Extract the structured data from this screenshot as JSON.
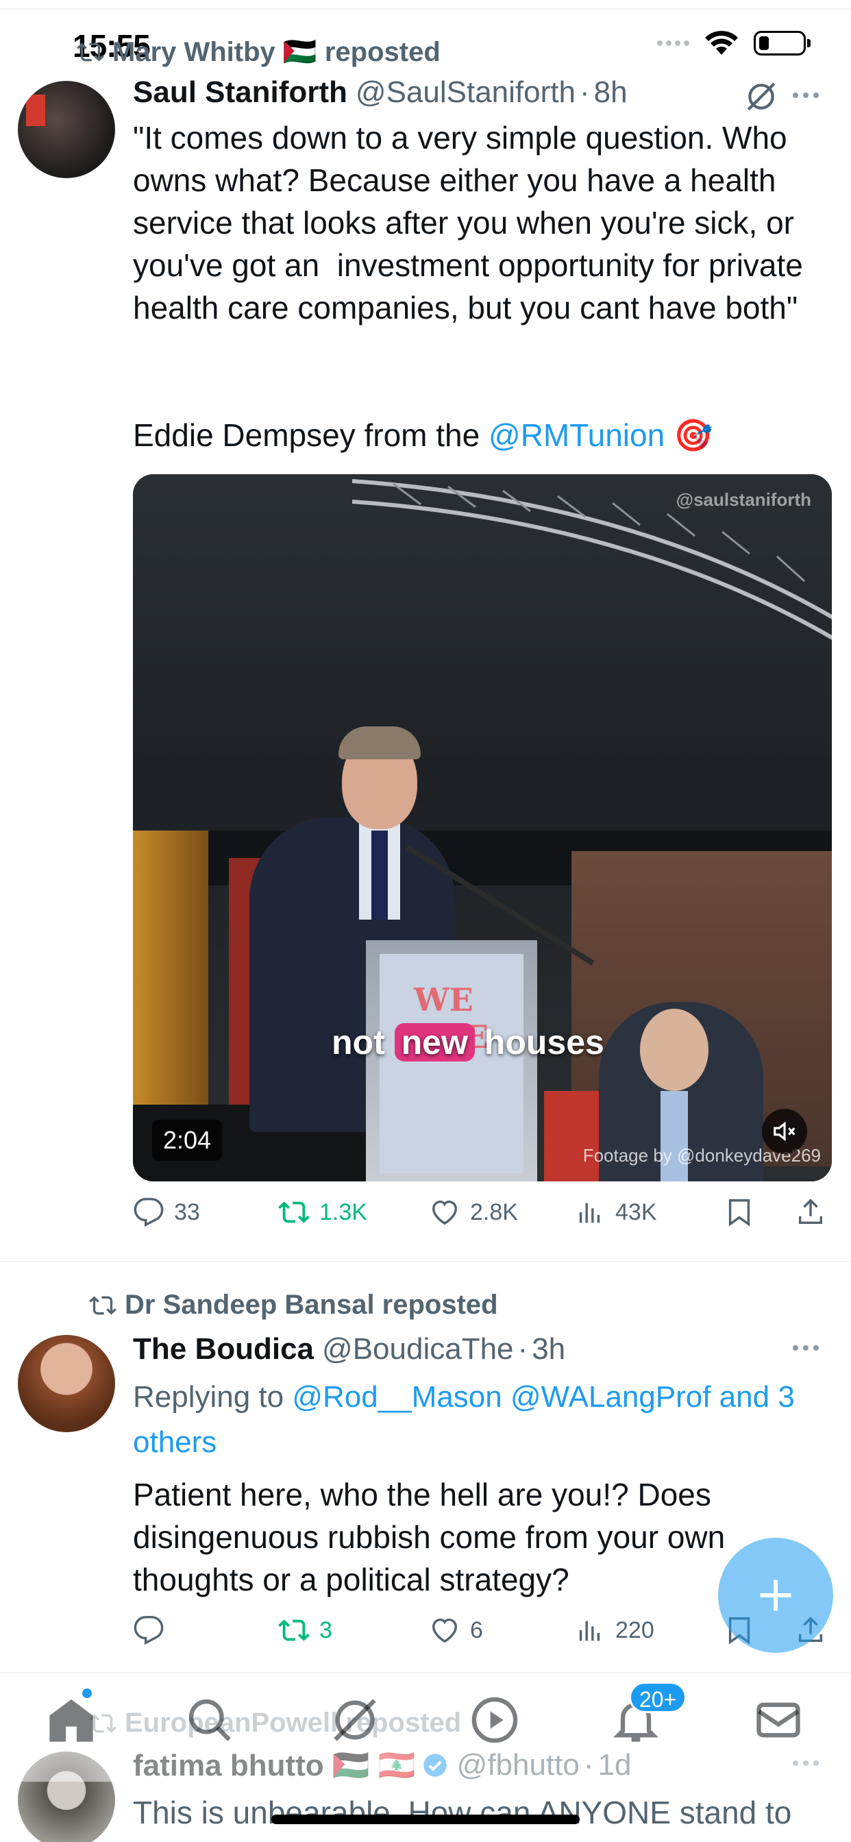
{
  "status_bar": {
    "time": "15:55"
  },
  "tweets": [
    {
      "context": "Mary Whitby 🇵🇸 reposted",
      "name": "Saul Staniforth",
      "handle": "@SaulStaniforth",
      "age": "8h",
      "text": "\"It comes down to a very simple question. Who owns what? Because either you have a health service that looks after you when you're sick, or you've got an  investment opportunity for private health care companies, but you cant have both\"",
      "text2_prefix": "Eddie Dempsey from the ",
      "text2_mention": "@RMTunion",
      "text2_emoji": "🎯",
      "media": {
        "watermark": "@saulstaniforth",
        "caption_before": "not ",
        "caption_highlight": "new",
        "caption_after": " houses",
        "podium_text": "WE ARE",
        "credit": "Footage by @donkeydave269",
        "duration": "2:04"
      },
      "stats": {
        "replies": "33",
        "reposts": "1.3K",
        "likes": "2.8K",
        "views": "43K"
      }
    },
    {
      "context": "Dr Sandeep Bansal reposted",
      "name": "The Boudica",
      "handle": "@BoudicaThe",
      "age": "3h",
      "reply_prefix": "Replying to ",
      "reply_to": "@Rod__Mason @WALangProf and 3 others",
      "text": "Patient here, who the hell are you!? Does disingenuous rubbish come from your own thoughts or a political strategy?",
      "stats": {
        "replies": "",
        "reposts": "3",
        "likes": "6",
        "views": "220"
      }
    },
    {
      "context": "EuropeanPowell reposted",
      "name": "fatima bhutto 🇵🇸 🇱🇧",
      "handle": "@fbhutto",
      "age": "1d",
      "text": "This is unbearable. How can ANYONE stand to"
    }
  ],
  "nav": {
    "notifications_badge": "20+"
  },
  "colors": {
    "accent": "#1d9bf0",
    "repost_green": "#00ba7c",
    "muted": "#536471"
  }
}
